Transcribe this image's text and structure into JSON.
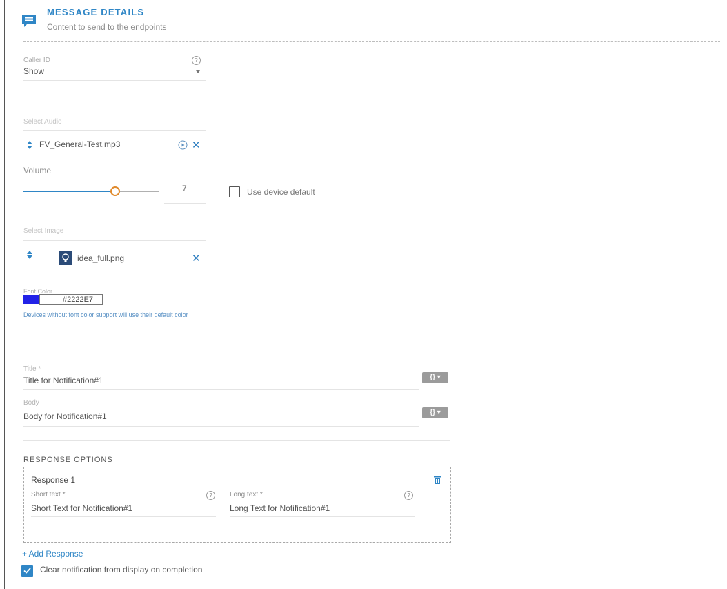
{
  "header": {
    "icon": "message-icon",
    "title": "MESSAGE DETAILS",
    "subtitle": "Content to send to the endpoints"
  },
  "caller_id": {
    "label": "Caller ID",
    "value": "Show",
    "help_icon": "help-icon"
  },
  "audio": {
    "label": "Select Audio",
    "file": "FV_General-Test.mp3",
    "icons": [
      "sort-arrows-icon",
      "play-icon",
      "close-icon"
    ]
  },
  "volume": {
    "label": "Volume",
    "value": "7",
    "level_fraction": 0.7,
    "device_default_label": "Use device default",
    "device_default_checked": false
  },
  "image": {
    "label": "Select Image",
    "file": "idea_full.png",
    "icons": [
      "sort-arrows-icon",
      "image-thumbnail-icon",
      "close-icon"
    ]
  },
  "font_color": {
    "label": "Font Color",
    "value": "#2222E7",
    "swatch_color": "#2222E7",
    "note": "Devices without font color support will use their default color"
  },
  "title_field": {
    "label": "Title *",
    "value": "Title for Notification#1",
    "variable_button": "{} ▾"
  },
  "body_field": {
    "label": "Body",
    "value": "Body for Notification#1",
    "variable_button": "{} ▾"
  },
  "response_options": {
    "heading": "RESPONSE OPTIONS",
    "responses": [
      {
        "title": "Response 1",
        "short_label": "Short text *",
        "short_value": "Short Text for Notification#1",
        "long_label": "Long text *",
        "long_value": "Long Text for Notification#1"
      }
    ],
    "add_label": "+ Add Response",
    "clear_label": "Clear notification from display on completion",
    "clear_checked": true
  },
  "colors": {
    "accent": "#2f86c6",
    "slider_thumb": "#e08a2c",
    "swatch": "#2222E7"
  }
}
